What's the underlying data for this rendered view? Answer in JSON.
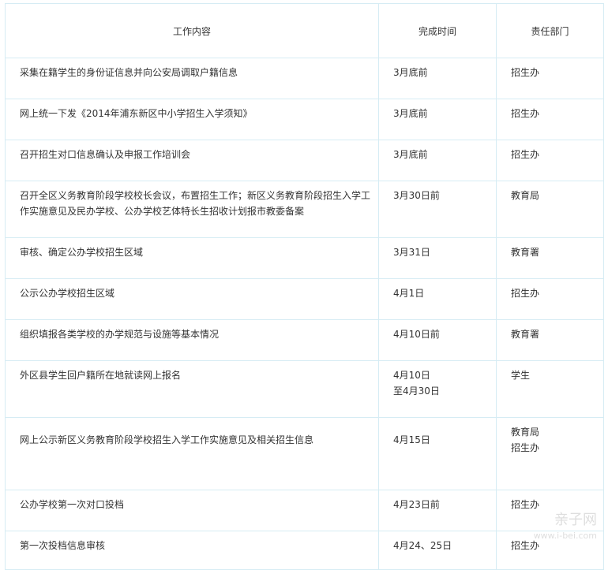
{
  "table": {
    "headers": [
      "工作内容",
      "完成时间",
      "责任部门"
    ],
    "rows": [
      {
        "task": "采集在籍学生的身份证信息并向公安局调取户籍信息",
        "time": "3月底前",
        "dept": "招生办"
      },
      {
        "task": "网上统一下发《2014年浦东新区中小学招生入学须知》",
        "time": "3月底前",
        "dept": "招生办"
      },
      {
        "task": "召开招生对口信息确认及申报工作培训会",
        "time": "3月底前",
        "dept": "招生办"
      },
      {
        "task_lines": [
          "召开全区义务教育阶段学校校长会议，布置招生工作；新区义务教育阶段招生入学工",
          "作实施意见及民办学校、公办学校艺体特长生招收计划报市教委备案"
        ],
        "time": "3月30日前",
        "dept": "教育局"
      },
      {
        "task": "审核、确定公办学校招生区域",
        "time": "3月31日",
        "dept": "教育署"
      },
      {
        "task": "公示公办学校招生区域",
        "time": "4月1日",
        "dept": "招生办"
      },
      {
        "task": "组织填报各类学校的办学规范与设施等基本情况",
        "time": "4月10日前",
        "dept": "教育署"
      },
      {
        "task": "外区县学生回户籍所在地就读网上报名",
        "time_lines": [
          "4月10日",
          "至4月30日"
        ],
        "dept": "学生"
      },
      {
        "task": "网上公示新区义务教育阶段学校招生入学工作实施意见及相关招生信息",
        "time": "4月15日",
        "dept_lines": [
          "教育局",
          "招生办"
        ]
      },
      {
        "task": "公办学校第一次对口投档",
        "time": "4月23日前",
        "dept": "招生办"
      },
      {
        "task": "第一次投档信息审核",
        "time": "4月24、25日",
        "dept": "招生办"
      }
    ]
  },
  "watermark": {
    "text": "亲子网",
    "sub": "www.i-bei.com"
  }
}
